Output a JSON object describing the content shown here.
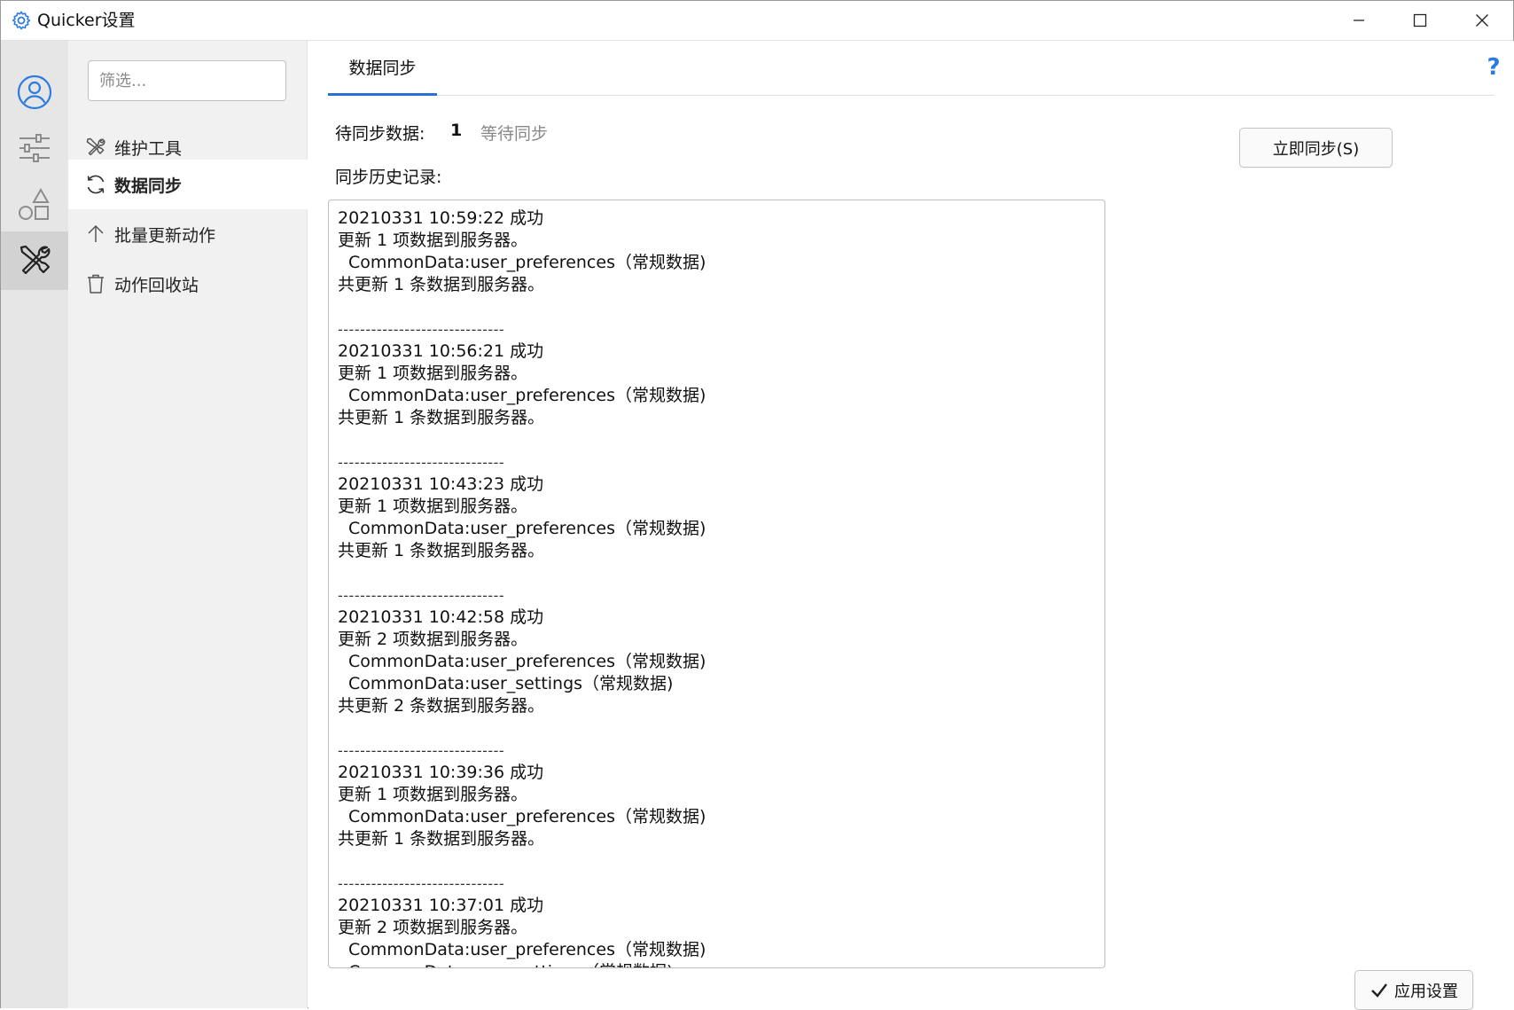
{
  "window": {
    "title": "Quicker设置",
    "icon": "gear-icon",
    "controls": [
      "minimize-icon",
      "maximize-icon",
      "close-icon"
    ]
  },
  "rail": {
    "items": [
      {
        "icon": "user-icon",
        "active": false
      },
      {
        "icon": "sliders-icon",
        "active": false
      },
      {
        "icon": "shapes-icon",
        "active": false
      },
      {
        "icon": "tools-icon",
        "active": true
      }
    ]
  },
  "nav": {
    "filter_placeholder": "筛选...",
    "items": [
      {
        "label": "维护工具",
        "icon": "wrench-screwdriver-icon",
        "active": false
      },
      {
        "label": "数据同步",
        "icon": "sync-icon",
        "active": true
      },
      {
        "label": "批量更新动作",
        "icon": "arrow-up-icon",
        "active": false
      },
      {
        "label": "动作回收站",
        "icon": "trash-icon",
        "active": false
      }
    ]
  },
  "main": {
    "tab": "数据同步",
    "help": "?",
    "pending_label": "待同步数据:",
    "pending_count": "1",
    "pending_status": "等待同步",
    "history_label": "同步历史记录:",
    "sync_button": "立即同步(S)",
    "apply_button": "应用设置",
    "separator": "------------------------------",
    "log": [
      {
        "header": "20210331 10:59:22 成功",
        "summary": "更新 1 项数据到服务器。",
        "items": [
          "CommonData:user_preferences（常规数据)"
        ],
        "total": "共更新 1 条数据到服务器。"
      },
      {
        "header": "20210331 10:56:21 成功",
        "summary": "更新 1 项数据到服务器。",
        "items": [
          "CommonData:user_preferences（常规数据)"
        ],
        "total": "共更新 1 条数据到服务器。"
      },
      {
        "header": "20210331 10:43:23 成功",
        "summary": "更新 1 项数据到服务器。",
        "items": [
          "CommonData:user_preferences（常规数据)"
        ],
        "total": "共更新 1 条数据到服务器。"
      },
      {
        "header": "20210331 10:42:58 成功",
        "summary": "更新 2 项数据到服务器。",
        "items": [
          "CommonData:user_preferences（常规数据)",
          "CommonData:user_settings（常规数据)"
        ],
        "total": "共更新 2 条数据到服务器。"
      },
      {
        "header": "20210331 10:39:36 成功",
        "summary": "更新 1 项数据到服务器。",
        "items": [
          "CommonData:user_preferences（常规数据)"
        ],
        "total": "共更新 1 条数据到服务器。"
      },
      {
        "header": "20210331 10:37:01 成功",
        "summary": "更新 2 项数据到服务器。",
        "items": [
          "CommonData:user_preferences（常规数据)",
          "CommonData:user_settings（常规数据)"
        ],
        "total": ""
      }
    ]
  }
}
